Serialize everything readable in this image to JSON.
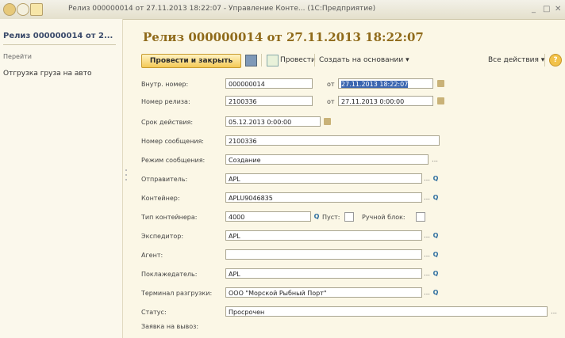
{
  "window": {
    "title": "Релиз 000000014 от 27.11.2013 18:22:07 - Управление Конте... (1С:Предприятие)",
    "controls": [
      "_",
      "□",
      "✕"
    ]
  },
  "sidebar": {
    "title": "Релиз 000000014 от 2...",
    "group": "Перейти",
    "item": "Отгрузка груза на авто"
  },
  "document": {
    "title": "Релиз 000000014 от 27.11.2013 18:22:07"
  },
  "toolbar": {
    "post_close": "Провести и закрыть",
    "post": "Провести",
    "create_based": "Создать на основании ▾",
    "all_actions": "Все действия ▾",
    "help": "?"
  },
  "form": {
    "internal_number_label": "Внутр. номер:",
    "internal_number": "000000014",
    "from_label": "от",
    "date1": "27.11.2013 18:22:07",
    "release_number_label": "Номер релиза:",
    "release_number": "2100336",
    "date2": "27.11.2013 0:00:00",
    "validity_label": "Срок действия:",
    "validity": "05.12.2013 0:00:00",
    "message_number_label": "Номер сообщения:",
    "message_number": "2100336",
    "message_mode_label": "Режим сообщения:",
    "message_mode": "Создание",
    "sender_label": "Отправитель:",
    "sender": "APL",
    "container_label": "Контейнер:",
    "container": "APLU9046835",
    "container_type_label": "Тип контейнера:",
    "container_type": "4000",
    "empty_label": "Пуст:",
    "manual_block_label": "Ручной блок:",
    "forwarder_label": "Экспедитор:",
    "forwarder": "APL",
    "agent_label": "Агент:",
    "agent": "",
    "client_label": "Поклажедатель:",
    "client": "APL",
    "terminal_label": "Терминал разгрузки:",
    "terminal": "ООО \"Морской Рыбный Порт\"",
    "status_label": "Статус:",
    "status": "Просрочен",
    "request_label": "Заявка на вывоз:"
  }
}
